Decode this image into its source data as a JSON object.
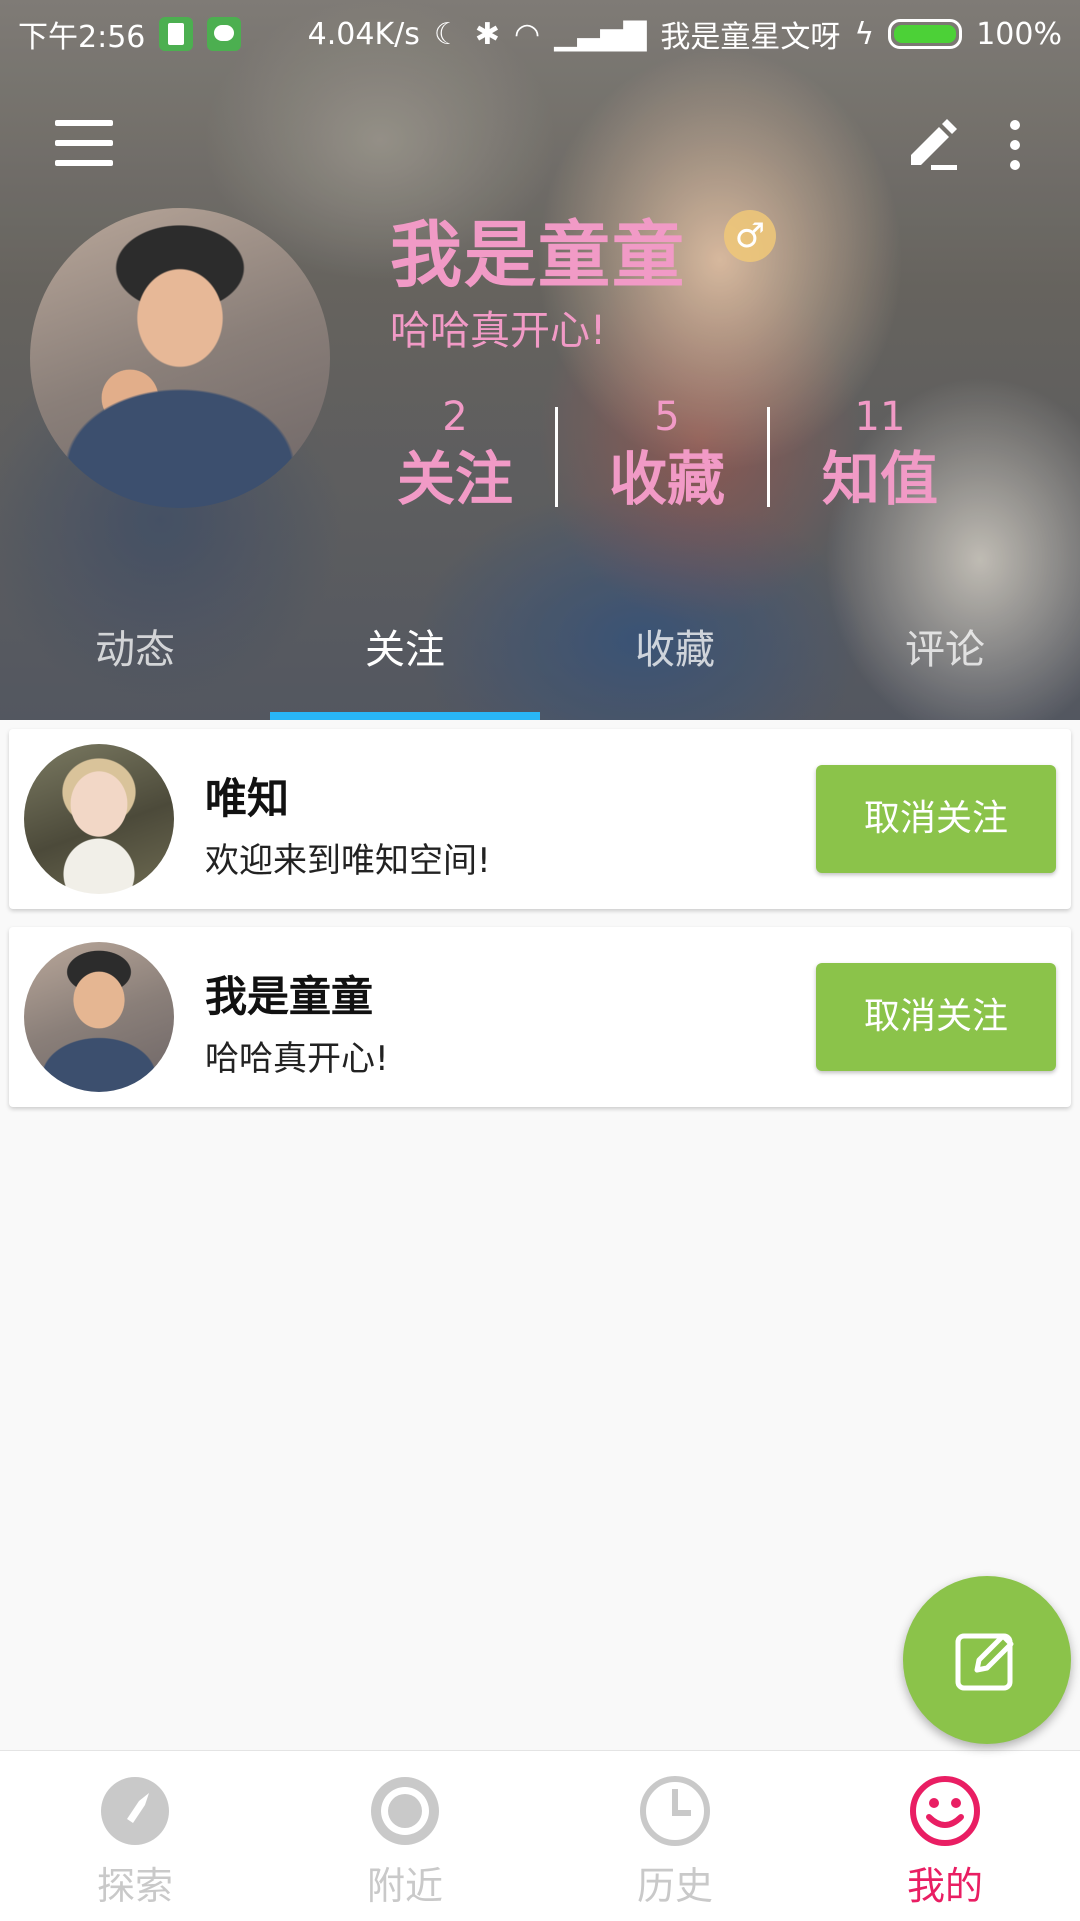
{
  "status_bar": {
    "time": "下午2:56",
    "net_speed": "4.04K/s",
    "carrier": "我是童星文呀",
    "battery": "100%"
  },
  "profile": {
    "name": "我是童童",
    "gender_symbol": "♂",
    "signature": "哈哈真开心!",
    "stats": [
      {
        "count": "2",
        "label": "关注"
      },
      {
        "count": "5",
        "label": "收藏"
      },
      {
        "count": "11",
        "label": "知值"
      }
    ]
  },
  "tabs": [
    {
      "label": "动态"
    },
    {
      "label": "关注",
      "active": true
    },
    {
      "label": "收藏"
    },
    {
      "label": "评论"
    }
  ],
  "following": [
    {
      "name": "唯知",
      "bio": "欢迎来到唯知空间!",
      "action": "取消关注"
    },
    {
      "name": "我是童童",
      "bio": "哈哈真开心!",
      "action": "取消关注"
    }
  ],
  "bottom_nav": [
    {
      "label": "探索",
      "icon": "compass-icon"
    },
    {
      "label": "附近",
      "icon": "target-icon"
    },
    {
      "label": "历史",
      "icon": "clock-icon"
    },
    {
      "label": "我的",
      "icon": "smiley-icon",
      "active": true
    }
  ],
  "colors": {
    "accent_pink": "#f19ac6",
    "button_green": "#8bc34a",
    "tab_indicator": "#29b6f6",
    "nav_active": "#e91e63",
    "nav_inactive": "#c9c9c9"
  }
}
